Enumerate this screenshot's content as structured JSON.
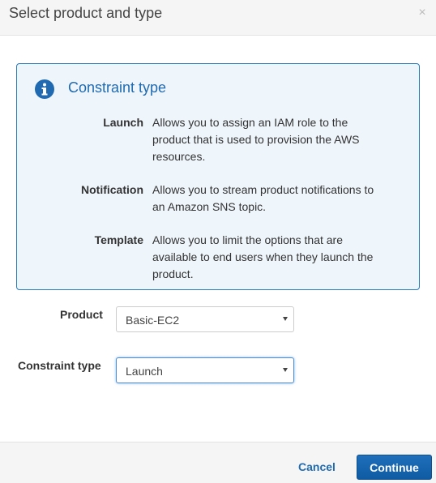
{
  "dialog": {
    "title": "Select product and type",
    "close_icon": "close-icon"
  },
  "info_box": {
    "icon": "info-icon",
    "title": "Constraint type",
    "accent_color": "#1f6ab0",
    "definitions": [
      {
        "term": "Launch",
        "description": "Allows you to assign an IAM role to the product that is used to provision the AWS resources."
      },
      {
        "term": "Notification",
        "description": "Allows you to stream product notifications to an Amazon SNS topic."
      },
      {
        "term": "Template",
        "description": "Allows you to limit the options that are available to end users when they launch the product."
      }
    ]
  },
  "form": {
    "product": {
      "label": "Product",
      "value": "Basic-EC2"
    },
    "constraint_type": {
      "label": "Constraint type",
      "value": "Launch"
    }
  },
  "footer": {
    "cancel_label": "Cancel",
    "continue_label": "Continue",
    "primary_color": "#1a66b1"
  }
}
